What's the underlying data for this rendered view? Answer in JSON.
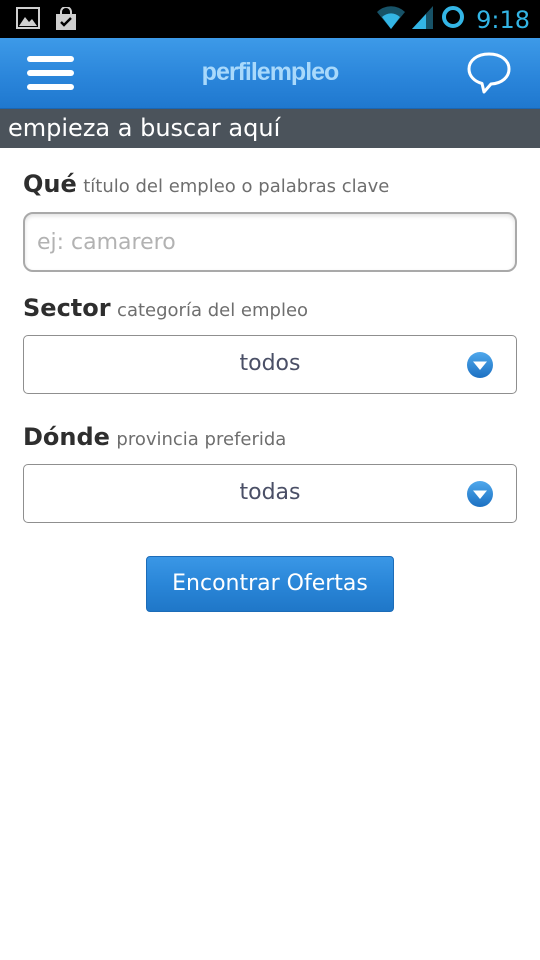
{
  "status_bar": {
    "time": "9:18",
    "icons": [
      "image-icon",
      "shopping-bag-icon",
      "wifi-icon",
      "signal-icon",
      "sync-ring-icon"
    ],
    "accent_color": "#33b5e5"
  },
  "header": {
    "brand": "perfilempleo",
    "menu_icon": "hamburger-menu-icon",
    "chat_icon": "speech-bubble-icon",
    "brand_color": "#a9d9fb",
    "background_color": "#2b86db"
  },
  "subheader": {
    "title": "empieza a buscar aquí",
    "background_color": "#4b535b"
  },
  "form": {
    "que": {
      "label": "Qué",
      "hint": "título del empleo o palabras clave",
      "placeholder": "ej: camarero",
      "value": ""
    },
    "sector": {
      "label": "Sector",
      "hint": "categoría del empleo",
      "selected": "todos"
    },
    "donde": {
      "label": "Dónde",
      "hint": "provincia preferida",
      "selected": "todas"
    },
    "submit_label": "Encontrar Ofertas"
  }
}
